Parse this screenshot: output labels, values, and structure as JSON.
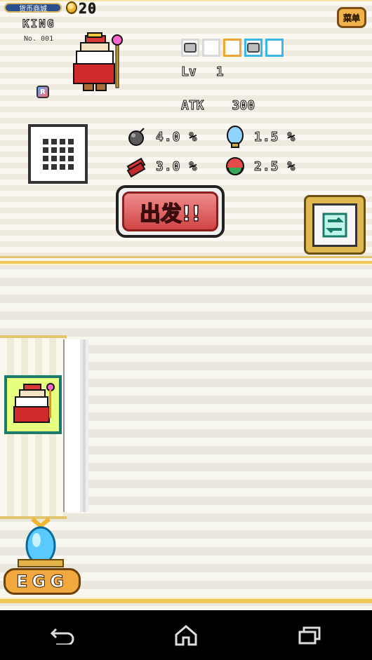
{
  "top_bar": {
    "currency_label": "货币商城",
    "coins": "20"
  },
  "character": {
    "name": "KING",
    "number": "No. 001",
    "level_label": "Lv",
    "level_value": "1",
    "atk_label": "ATK",
    "atk_value": "300",
    "rank_badge": "R",
    "color_slots": [
      "#d9d9d9",
      "#d9d9d9",
      "#f3a632",
      "#39b7e9",
      "#39b7e9"
    ]
  },
  "stats": [
    {
      "icon": "bomb-icon",
      "value": "4.0 %"
    },
    {
      "icon": "mirror-icon",
      "value": "1.5 %"
    },
    {
      "icon": "dynamite-icon",
      "value": "3.0 %"
    },
    {
      "icon": "cycle-icon",
      "value": "2.5 %"
    }
  ],
  "buttons": {
    "go_label": "出发!!",
    "menu_label": "菜单",
    "egg_label": "EGG"
  },
  "colors": {
    "gold": "#f0c85a",
    "go_red": "#d04545",
    "teal": "#1b7b6a",
    "navbar": "#000000"
  }
}
